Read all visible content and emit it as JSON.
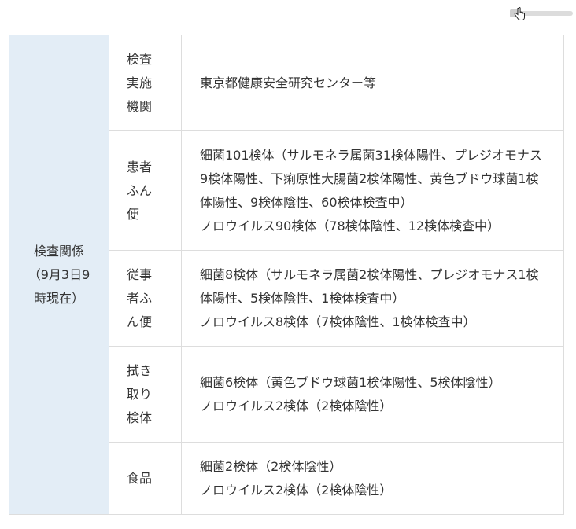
{
  "table": {
    "header": "検査関係（9月3日9時現在）",
    "rows": [
      {
        "category": "検査実施機関",
        "lines": [
          "東京都健康安全研究センター等"
        ]
      },
      {
        "category": "患者ふん便",
        "lines": [
          "細菌101検体（サルモネラ属菌31検体陽性、プレジオモナス9検体陽性、下痢原性大腸菌2検体陽性、黄色ブドウ球菌1検体陽性、9検体陰性、60検体検査中）",
          "ノロウイルス90検体（78検体陰性、12検体検査中）"
        ]
      },
      {
        "category": "従事者ふん便",
        "lines": [
          "細菌8検体（サルモネラ属菌2検体陽性、プレジオモナス1検体陽性、5検体陰性、1検体検査中）",
          "ノロウイルス8検体（7検体陰性、1検体検査中）"
        ]
      },
      {
        "category": "拭き取り検体",
        "lines": [
          "細菌6検体（黄色ブドウ球菌1検体陽性、5検体陰性）",
          "ノロウイルス2検体（2検体陰性）"
        ]
      },
      {
        "category": "食品",
        "lines": [
          "細菌2検体（2検体陰性）",
          "ノロウイルス2検体（2検体陰性）"
        ]
      }
    ]
  }
}
